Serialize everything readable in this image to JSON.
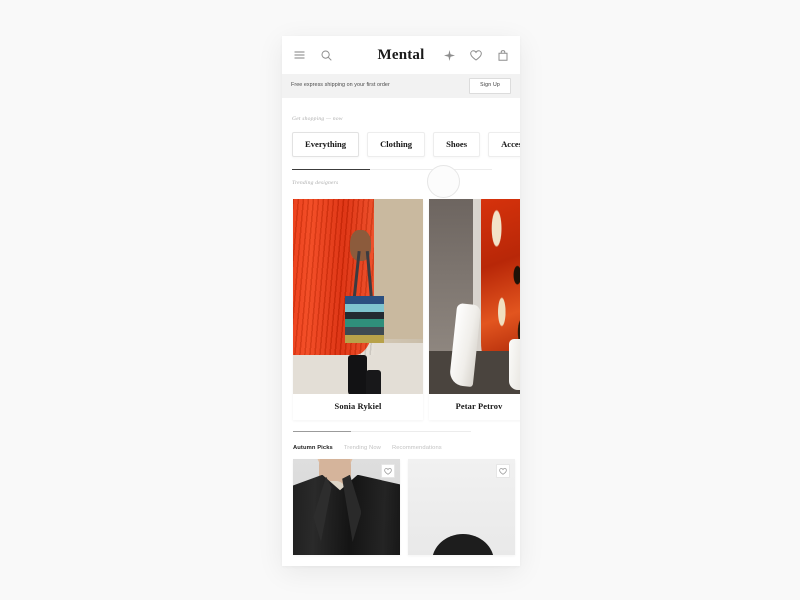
{
  "app": {
    "brand": "Mental",
    "background_color": "#f9f9f9"
  },
  "topnav": {
    "menu_icon": "hamburger-menu-icon",
    "search_icon": "search-icon",
    "flash_icon": "sparkle-icon",
    "wishlist_icon": "heart-icon",
    "bag_icon": "shopping-bag-icon"
  },
  "announcement": {
    "text": "Free express shipping on your first order",
    "cta_label": "Sign Up",
    "background_color": "#f2f2f2"
  },
  "categories": {
    "eyebrow": "Get shopping — now",
    "chips": [
      {
        "label": "Everything",
        "active": true
      },
      {
        "label": "Clothing",
        "active": false
      },
      {
        "label": "Shoes",
        "active": false
      },
      {
        "label": "Accessories",
        "active": false
      }
    ]
  },
  "designers": {
    "eyebrow": "Trending designers",
    "cards": [
      {
        "name": "Sonia Rykiel"
      },
      {
        "name": "Petar Petrov"
      }
    ]
  },
  "product_tabs": [
    {
      "label": "Autumn Picks",
      "active": true
    },
    {
      "label": "Trending Now",
      "active": false
    },
    {
      "label": "Recommendations",
      "active": false
    }
  ],
  "products": [
    {
      "fav_icon": "heart-outline-icon"
    },
    {
      "fav_icon": "heart-outline-icon"
    }
  ]
}
